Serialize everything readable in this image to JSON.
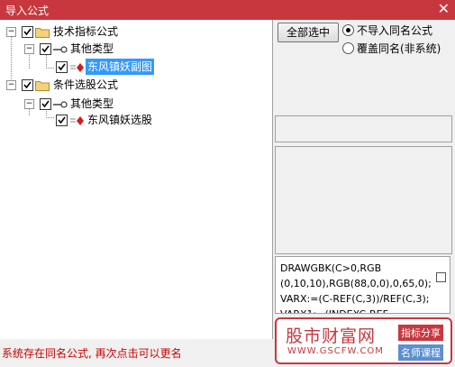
{
  "window": {
    "title": "导入公式",
    "close_glyph": "✕"
  },
  "tree": {
    "nodes": [
      {
        "label": "技术指标公式",
        "icon": "folder-icon",
        "checked": true,
        "expander": "−"
      },
      {
        "label": "其他类型",
        "icon": "key-icon",
        "checked": true,
        "expander": "−"
      },
      {
        "label": "东风镇妖副图",
        "icon": "formula-icon",
        "checked": true,
        "selected": true
      },
      {
        "label": "条件选股公式",
        "icon": "folder-icon",
        "checked": true,
        "expander": "−"
      },
      {
        "label": "其他类型",
        "icon": "key-icon",
        "checked": true,
        "expander": "−"
      },
      {
        "label": "东风镇妖选股",
        "icon": "formula-icon",
        "checked": true
      }
    ]
  },
  "buttons": {
    "select_all": "全部选中"
  },
  "options": {
    "no_import_same_name": "不导入同名公式",
    "overwrite_same_name": "覆盖同名(非系统)",
    "selected": "no_import_same_name"
  },
  "code": {
    "lines": [
      "DRAWGBK(C>0,RGB",
      "(0,10,10),RGB(88,0,0),0,65,0);",
      "VARX:=(C-REF(C,3))/REF(C,3);",
      "VARX1:=(INDEXC-REF"
    ]
  },
  "status": {
    "message": "系统存在同名公式, 再次点击可以更名"
  },
  "watermark": {
    "name": "股市财富网",
    "url": "WWW.GSCFW.COM",
    "tag1": "指标分享",
    "tag2": "名师课程",
    "brand_color": "#c8373e",
    "accent_color": "#5b8fd0"
  }
}
